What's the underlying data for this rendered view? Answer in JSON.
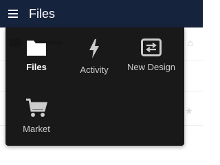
{
  "header": {
    "title": "Files",
    "menu_icon": "hamburger-menu-icon",
    "background": "#16233d"
  },
  "app_menu": {
    "items": [
      {
        "label": "Files",
        "icon": "folder-icon",
        "active": true
      },
      {
        "label": "Activity",
        "icon": "lightning-icon",
        "active": false
      },
      {
        "label": "New Design",
        "icon": "transfer-arrows-icon",
        "active": false
      },
      {
        "label": "Market",
        "icon": "shopping-cart-icon",
        "active": false
      }
    ]
  },
  "background_page": {
    "icons": [
      "home-icon",
      "star-icon"
    ]
  }
}
